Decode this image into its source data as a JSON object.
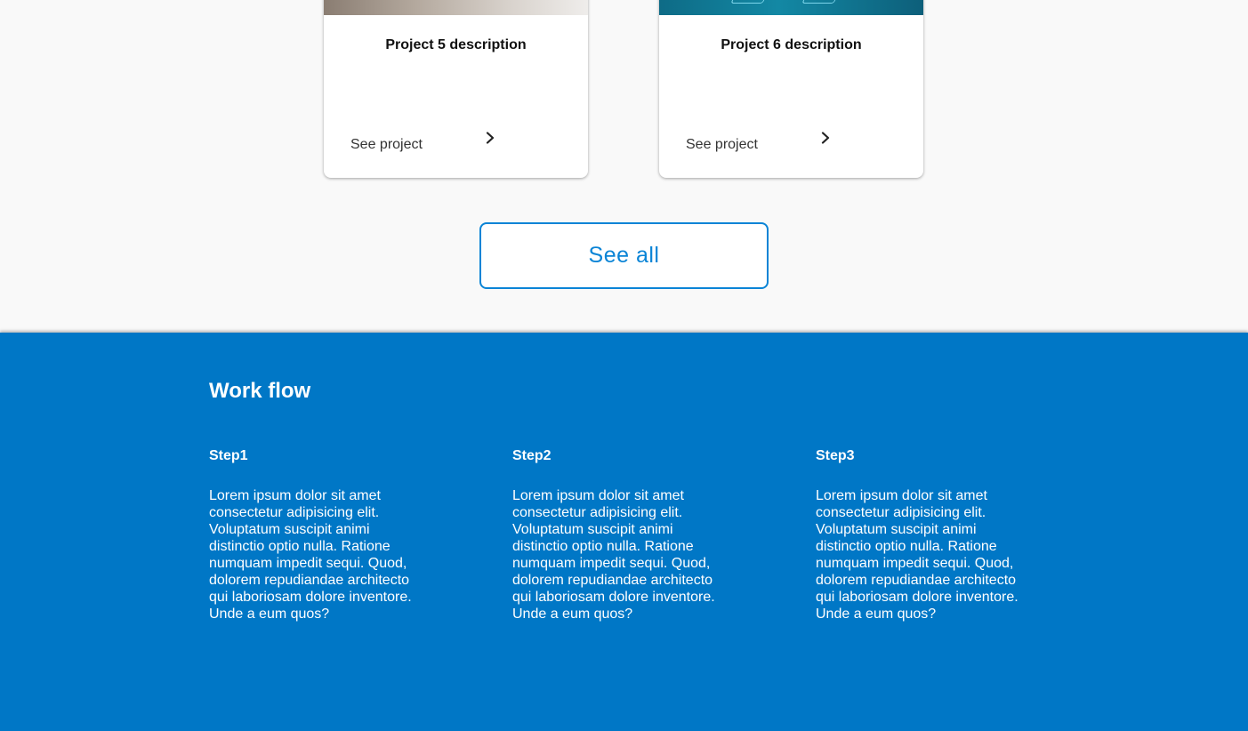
{
  "projects": {
    "cards": [
      {
        "title": "Project 5 description",
        "link_label": "See project"
      },
      {
        "title": "Project 6 description",
        "link_label": "See project"
      }
    ],
    "see_all_label": "See all"
  },
  "workflow": {
    "title": "Work flow",
    "steps": [
      {
        "title": "Step1",
        "text": "Lorem ipsum dolor sit amet consectetur adipisicing elit. Voluptatum suscipit animi distinctio optio nulla. Ratione numquam impedit sequi. Quod, dolorem repudiandae architecto qui laboriosam dolore inventore. Unde a eum quos?"
      },
      {
        "title": "Step2",
        "text": "Lorem ipsum dolor sit amet consectetur adipisicing elit. Voluptatum suscipit animi distinctio optio nulla. Ratione numquam impedit sequi. Quod, dolorem repudiandae architecto qui laboriosam dolore inventore. Unde a eum quos?"
      },
      {
        "title": "Step3",
        "text": "Lorem ipsum dolor sit amet consectetur adipisicing elit. Voluptatum suscipit animi distinctio optio nulla. Ratione numquam impedit sequi. Quod, dolorem repudiandae architecto qui laboriosam dolore inventore. Unde a eum quos?"
      }
    ]
  },
  "colors": {
    "accent": "#0a84d6",
    "workflow_background": "#0077c6",
    "page_background": "#f9f9f9"
  },
  "icons": {
    "card_link": "chevron-right-icon"
  }
}
